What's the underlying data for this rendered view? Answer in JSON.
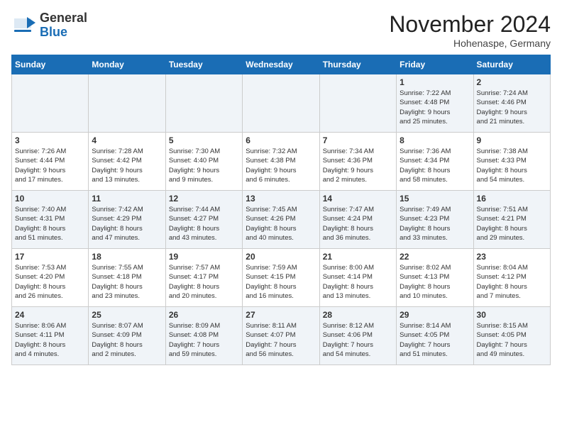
{
  "logo": {
    "general": "General",
    "blue": "Blue"
  },
  "title": "November 2024",
  "subtitle": "Hohenaspe, Germany",
  "days_of_week": [
    "Sunday",
    "Monday",
    "Tuesday",
    "Wednesday",
    "Thursday",
    "Friday",
    "Saturday"
  ],
  "weeks": [
    [
      {
        "day": "",
        "info": ""
      },
      {
        "day": "",
        "info": ""
      },
      {
        "day": "",
        "info": ""
      },
      {
        "day": "",
        "info": ""
      },
      {
        "day": "",
        "info": ""
      },
      {
        "day": "1",
        "info": "Sunrise: 7:22 AM\nSunset: 4:48 PM\nDaylight: 9 hours\nand 25 minutes."
      },
      {
        "day": "2",
        "info": "Sunrise: 7:24 AM\nSunset: 4:46 PM\nDaylight: 9 hours\nand 21 minutes."
      }
    ],
    [
      {
        "day": "3",
        "info": "Sunrise: 7:26 AM\nSunset: 4:44 PM\nDaylight: 9 hours\nand 17 minutes."
      },
      {
        "day": "4",
        "info": "Sunrise: 7:28 AM\nSunset: 4:42 PM\nDaylight: 9 hours\nand 13 minutes."
      },
      {
        "day": "5",
        "info": "Sunrise: 7:30 AM\nSunset: 4:40 PM\nDaylight: 9 hours\nand 9 minutes."
      },
      {
        "day": "6",
        "info": "Sunrise: 7:32 AM\nSunset: 4:38 PM\nDaylight: 9 hours\nand 6 minutes."
      },
      {
        "day": "7",
        "info": "Sunrise: 7:34 AM\nSunset: 4:36 PM\nDaylight: 9 hours\nand 2 minutes."
      },
      {
        "day": "8",
        "info": "Sunrise: 7:36 AM\nSunset: 4:34 PM\nDaylight: 8 hours\nand 58 minutes."
      },
      {
        "day": "9",
        "info": "Sunrise: 7:38 AM\nSunset: 4:33 PM\nDaylight: 8 hours\nand 54 minutes."
      }
    ],
    [
      {
        "day": "10",
        "info": "Sunrise: 7:40 AM\nSunset: 4:31 PM\nDaylight: 8 hours\nand 51 minutes."
      },
      {
        "day": "11",
        "info": "Sunrise: 7:42 AM\nSunset: 4:29 PM\nDaylight: 8 hours\nand 47 minutes."
      },
      {
        "day": "12",
        "info": "Sunrise: 7:44 AM\nSunset: 4:27 PM\nDaylight: 8 hours\nand 43 minutes."
      },
      {
        "day": "13",
        "info": "Sunrise: 7:45 AM\nSunset: 4:26 PM\nDaylight: 8 hours\nand 40 minutes."
      },
      {
        "day": "14",
        "info": "Sunrise: 7:47 AM\nSunset: 4:24 PM\nDaylight: 8 hours\nand 36 minutes."
      },
      {
        "day": "15",
        "info": "Sunrise: 7:49 AM\nSunset: 4:23 PM\nDaylight: 8 hours\nand 33 minutes."
      },
      {
        "day": "16",
        "info": "Sunrise: 7:51 AM\nSunset: 4:21 PM\nDaylight: 8 hours\nand 29 minutes."
      }
    ],
    [
      {
        "day": "17",
        "info": "Sunrise: 7:53 AM\nSunset: 4:20 PM\nDaylight: 8 hours\nand 26 minutes."
      },
      {
        "day": "18",
        "info": "Sunrise: 7:55 AM\nSunset: 4:18 PM\nDaylight: 8 hours\nand 23 minutes."
      },
      {
        "day": "19",
        "info": "Sunrise: 7:57 AM\nSunset: 4:17 PM\nDaylight: 8 hours\nand 20 minutes."
      },
      {
        "day": "20",
        "info": "Sunrise: 7:59 AM\nSunset: 4:15 PM\nDaylight: 8 hours\nand 16 minutes."
      },
      {
        "day": "21",
        "info": "Sunrise: 8:00 AM\nSunset: 4:14 PM\nDaylight: 8 hours\nand 13 minutes."
      },
      {
        "day": "22",
        "info": "Sunrise: 8:02 AM\nSunset: 4:13 PM\nDaylight: 8 hours\nand 10 minutes."
      },
      {
        "day": "23",
        "info": "Sunrise: 8:04 AM\nSunset: 4:12 PM\nDaylight: 8 hours\nand 7 minutes."
      }
    ],
    [
      {
        "day": "24",
        "info": "Sunrise: 8:06 AM\nSunset: 4:11 PM\nDaylight: 8 hours\nand 4 minutes."
      },
      {
        "day": "25",
        "info": "Sunrise: 8:07 AM\nSunset: 4:09 PM\nDaylight: 8 hours\nand 2 minutes."
      },
      {
        "day": "26",
        "info": "Sunrise: 8:09 AM\nSunset: 4:08 PM\nDaylight: 7 hours\nand 59 minutes."
      },
      {
        "day": "27",
        "info": "Sunrise: 8:11 AM\nSunset: 4:07 PM\nDaylight: 7 hours\nand 56 minutes."
      },
      {
        "day": "28",
        "info": "Sunrise: 8:12 AM\nSunset: 4:06 PM\nDaylight: 7 hours\nand 54 minutes."
      },
      {
        "day": "29",
        "info": "Sunrise: 8:14 AM\nSunset: 4:05 PM\nDaylight: 7 hours\nand 51 minutes."
      },
      {
        "day": "30",
        "info": "Sunrise: 8:15 AM\nSunset: 4:05 PM\nDaylight: 7 hours\nand 49 minutes."
      }
    ]
  ]
}
